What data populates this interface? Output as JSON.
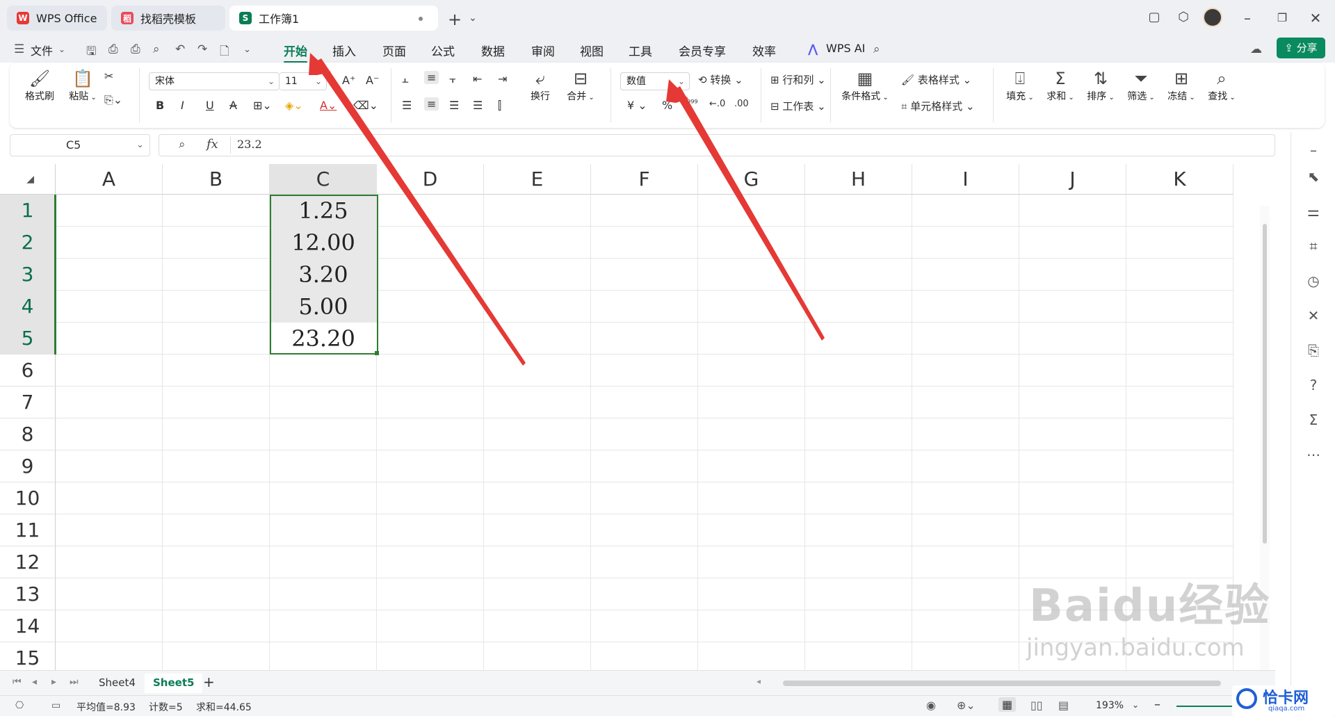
{
  "tabs": [
    {
      "label": "WPS Office",
      "logo": "W"
    },
    {
      "label": "找稻壳模板",
      "logo": "稻"
    },
    {
      "label": "工作簿1",
      "logo": "S"
    }
  ],
  "menu": {
    "file": "文件",
    "items": [
      "开始",
      "插入",
      "页面",
      "公式",
      "数据",
      "审阅",
      "视图",
      "工具",
      "会员专享",
      "效率"
    ],
    "wps_ai": "WPS AI",
    "share": "分享"
  },
  "ribbon": {
    "format_painter": "格式刷",
    "paste": "粘贴",
    "font_name": "宋体",
    "font_size": "11",
    "wrap": "换行",
    "merge": "合并",
    "number_format": "数值",
    "convert": "转换",
    "row_col": "行和列",
    "worksheet": "工作表",
    "conditional": "条件格式",
    "table_style": "表格样式",
    "cell_style": "单元格样式",
    "fill": "填充",
    "sum": "求和",
    "sort": "排序",
    "filter": "筛选",
    "freeze": "冻结",
    "find": "查找",
    "currency": "¥",
    "percent": "%"
  },
  "formula_bar": {
    "name_box": "C5",
    "fx": "fx",
    "value": "23.2"
  },
  "columns": [
    "A",
    "B",
    "C",
    "D",
    "E",
    "F",
    "G",
    "H",
    "I",
    "J",
    "K"
  ],
  "rows": [
    "1",
    "2",
    "3",
    "4",
    "5",
    "6",
    "7",
    "8",
    "9",
    "10",
    "11",
    "12",
    "13",
    "14",
    "15"
  ],
  "cells_c": [
    "1.25",
    "12.00",
    "3.20",
    "5.00",
    "23.20"
  ],
  "sheets": [
    "Sheet4",
    "Sheet5"
  ],
  "status": {
    "average": "平均值=8.93",
    "count": "计数=5",
    "sum": "求和=44.65",
    "zoom": "193%"
  },
  "watermark": {
    "brand": "Baidu经验",
    "url": "jingyan.baidu.com",
    "corner": "恰卡网",
    "corner_url": "qiaqa.com"
  },
  "colors": {
    "accent": "#0a7d55",
    "arrow": "#e53935",
    "selection": "#2e7d32"
  }
}
